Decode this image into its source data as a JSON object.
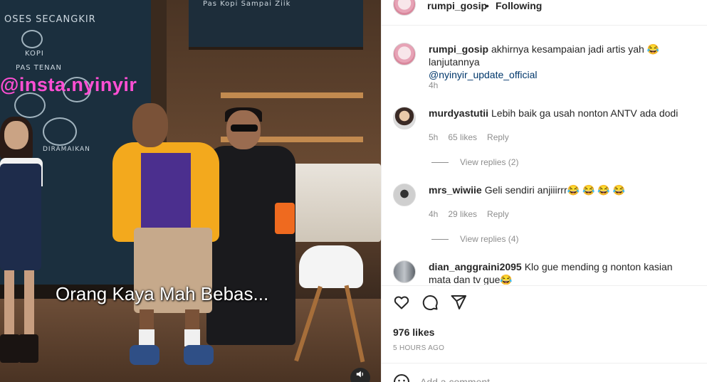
{
  "video": {
    "watermark": "@insta.nyinyir",
    "subtitle": "Orang Kaya Mah Bebas...",
    "board_text": [
      "OSES SECANGKIR",
      "KOPI",
      "PAS TENAN",
      "DIRAMAIKAN"
    ],
    "menu_board_text": "Pas Kopi Sampai Ziik",
    "mute_icon": "speaker-icon"
  },
  "header": {
    "username": "rumpi_gosip",
    "separator": "•",
    "follow_status": "Following"
  },
  "caption": {
    "username": "rumpi_gosip",
    "text": "akhirnya kesampaian jadi artis yah 😂 lanjutannya",
    "mention": "@nyinyir_update_official",
    "time": "4h"
  },
  "comments": [
    {
      "username": "murdyastutii",
      "text": "Lebih baik ga usah nonton ANTV ada dodi",
      "time": "5h",
      "likes": "65 likes",
      "reply": "Reply",
      "view_replies": "View replies (2)"
    },
    {
      "username": "mrs_wiwiie",
      "text": "Geli sendiri anjiiirrr😂 😂 😂 😂",
      "time": "4h",
      "likes": "29 likes",
      "reply": "Reply",
      "view_replies": "View replies (4)"
    },
    {
      "username": "dian_anggraini2095",
      "text": "Klo gue mending g nonton kasian mata dan tv gue😂"
    }
  ],
  "actions": {
    "like_icon": "heart-icon",
    "comment_icon": "comment-icon",
    "share_icon": "send-icon"
  },
  "likes": "976 likes",
  "posted": "5 HOURS AGO",
  "add_comment": {
    "placeholder": "Add a comment...",
    "emoji_icon": "emoji-icon"
  }
}
